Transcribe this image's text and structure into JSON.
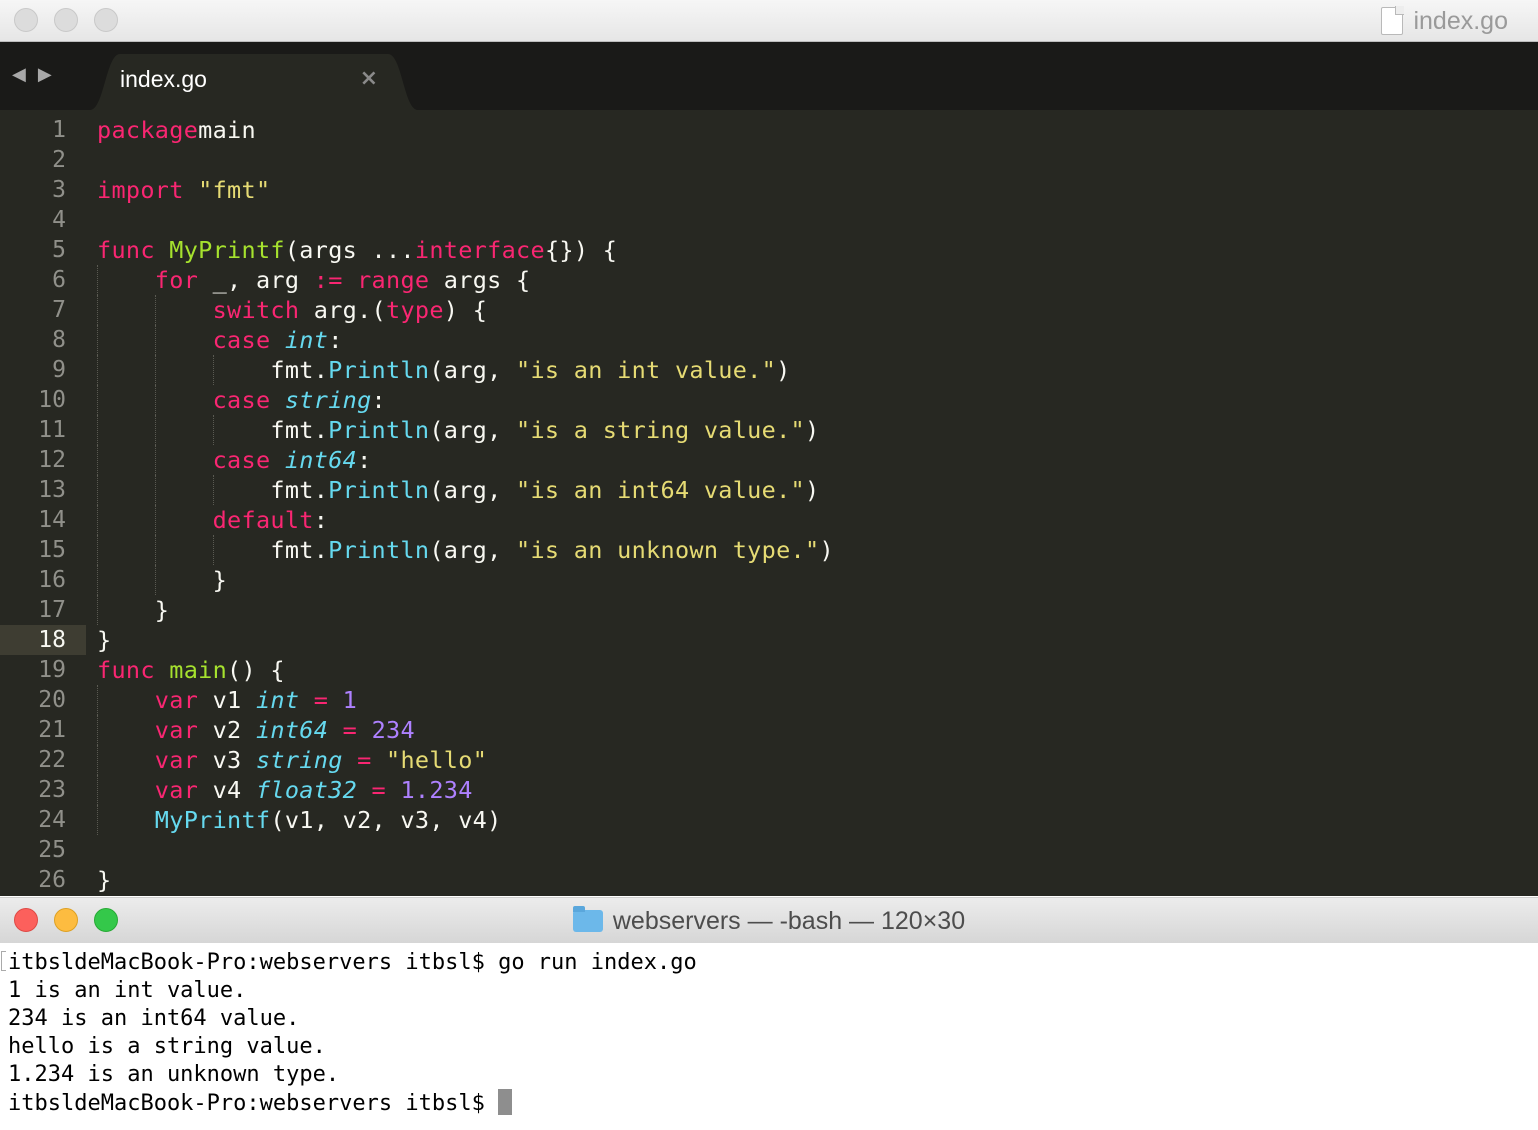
{
  "editor": {
    "window_title": "index.go",
    "tab_label": "index.go",
    "tab_close_glyph": "×",
    "nav_back_glyph": "◀",
    "nav_forward_glyph": "▶",
    "current_line": 18,
    "line_numbers": [
      "1",
      "2",
      "3",
      "4",
      "5",
      "6",
      "7",
      "8",
      "9",
      "10",
      "11",
      "12",
      "13",
      "14",
      "15",
      "16",
      "17",
      "18",
      "19",
      "20",
      "21",
      "22",
      "23",
      "24",
      "25",
      "26"
    ],
    "lines": [
      [
        [
          "k",
          "package"
        ],
        [
          "",
          "main"
        ]
      ],
      [],
      [
        [
          "k",
          "import"
        ],
        [
          "",
          " "
        ],
        [
          "s",
          "\"fmt\""
        ]
      ],
      [],
      [
        [
          "k",
          "func"
        ],
        [
          "",
          " "
        ],
        [
          "f",
          "MyPrintf"
        ],
        [
          "",
          "(args ..."
        ],
        [
          "k",
          "interface"
        ],
        [
          "",
          "{}) {"
        ]
      ],
      [
        [
          "",
          "    "
        ],
        [
          "k",
          "for"
        ],
        [
          "",
          " _, arg "
        ],
        [
          "k",
          ":="
        ],
        [
          "",
          " "
        ],
        [
          "k",
          "range"
        ],
        [
          "",
          " args {"
        ]
      ],
      [
        [
          "",
          "        "
        ],
        [
          "k",
          "switch"
        ],
        [
          "",
          " arg.("
        ],
        [
          "k",
          "type"
        ],
        [
          "",
          ") {"
        ]
      ],
      [
        [
          "",
          "        "
        ],
        [
          "k",
          "case"
        ],
        [
          "",
          " "
        ],
        [
          "t",
          "int"
        ],
        [
          "",
          ":"
        ]
      ],
      [
        [
          "",
          "            fmt."
        ],
        [
          "b",
          "Println"
        ],
        [
          "",
          "(arg, "
        ],
        [
          "s",
          "\"is an int value.\""
        ],
        [
          "",
          ")"
        ]
      ],
      [
        [
          "",
          "        "
        ],
        [
          "k",
          "case"
        ],
        [
          "",
          " "
        ],
        [
          "t",
          "string"
        ],
        [
          "",
          ":"
        ]
      ],
      [
        [
          "",
          "            fmt."
        ],
        [
          "b",
          "Println"
        ],
        [
          "",
          "(arg, "
        ],
        [
          "s",
          "\"is a string value.\""
        ],
        [
          "",
          ")"
        ]
      ],
      [
        [
          "",
          "        "
        ],
        [
          "k",
          "case"
        ],
        [
          "",
          " "
        ],
        [
          "t",
          "int64"
        ],
        [
          "",
          ":"
        ]
      ],
      [
        [
          "",
          "            fmt."
        ],
        [
          "b",
          "Println"
        ],
        [
          "",
          "(arg, "
        ],
        [
          "s",
          "\"is an int64 value.\""
        ],
        [
          "",
          ")"
        ]
      ],
      [
        [
          "",
          "        "
        ],
        [
          "k",
          "default"
        ],
        [
          "",
          ":"
        ]
      ],
      [
        [
          "",
          "            fmt."
        ],
        [
          "b",
          "Println"
        ],
        [
          "",
          "(arg, "
        ],
        [
          "s",
          "\"is an unknown type.\""
        ],
        [
          "",
          ")"
        ]
      ],
      [
        [
          "",
          "        }"
        ]
      ],
      [
        [
          "",
          "    }"
        ]
      ],
      [
        [
          "",
          "}"
        ]
      ],
      [
        [
          "k",
          "func"
        ],
        [
          "",
          " "
        ],
        [
          "f",
          "main"
        ],
        [
          "",
          "() {"
        ]
      ],
      [
        [
          "",
          "    "
        ],
        [
          "k",
          "var"
        ],
        [
          "",
          " v1 "
        ],
        [
          "t",
          "int"
        ],
        [
          "",
          " "
        ],
        [
          "k",
          "="
        ],
        [
          "",
          " "
        ],
        [
          "n",
          "1"
        ]
      ],
      [
        [
          "",
          "    "
        ],
        [
          "k",
          "var"
        ],
        [
          "",
          " v2 "
        ],
        [
          "t",
          "int64"
        ],
        [
          "",
          " "
        ],
        [
          "k",
          "="
        ],
        [
          "",
          " "
        ],
        [
          "n",
          "234"
        ]
      ],
      [
        [
          "",
          "    "
        ],
        [
          "k",
          "var"
        ],
        [
          "",
          " v3 "
        ],
        [
          "t",
          "string"
        ],
        [
          "",
          " "
        ],
        [
          "k",
          "="
        ],
        [
          "",
          " "
        ],
        [
          "s",
          "\"hello\""
        ]
      ],
      [
        [
          "",
          "    "
        ],
        [
          "k",
          "var"
        ],
        [
          "",
          " v4 "
        ],
        [
          "t",
          "float32"
        ],
        [
          "",
          " "
        ],
        [
          "k",
          "="
        ],
        [
          "",
          " "
        ],
        [
          "n",
          "1.234"
        ]
      ],
      [
        [
          "",
          "    "
        ],
        [
          "b",
          "MyPrintf"
        ],
        [
          "",
          "(v1, v2, v3, v4)"
        ]
      ],
      [],
      [
        [
          "",
          "}"
        ]
      ]
    ]
  },
  "terminal": {
    "window_title": "webservers — -bash — 120×30",
    "lines": [
      "itbsldeMacBook-Pro:webservers itbsl$ go run index.go",
      "1 is an int value.",
      "234 is an int64 value.",
      "hello is a string value.",
      "1.234 is an unknown type.",
      "itbsldeMacBook-Pro:webservers itbsl$ "
    ]
  },
  "colors": {
    "editor_bg": "#272822",
    "keyword": "#f92672",
    "string": "#e6db74",
    "number": "#ae81ff",
    "function": "#a6e22e",
    "type": "#66d9ef",
    "plain": "#f8f8f2"
  }
}
